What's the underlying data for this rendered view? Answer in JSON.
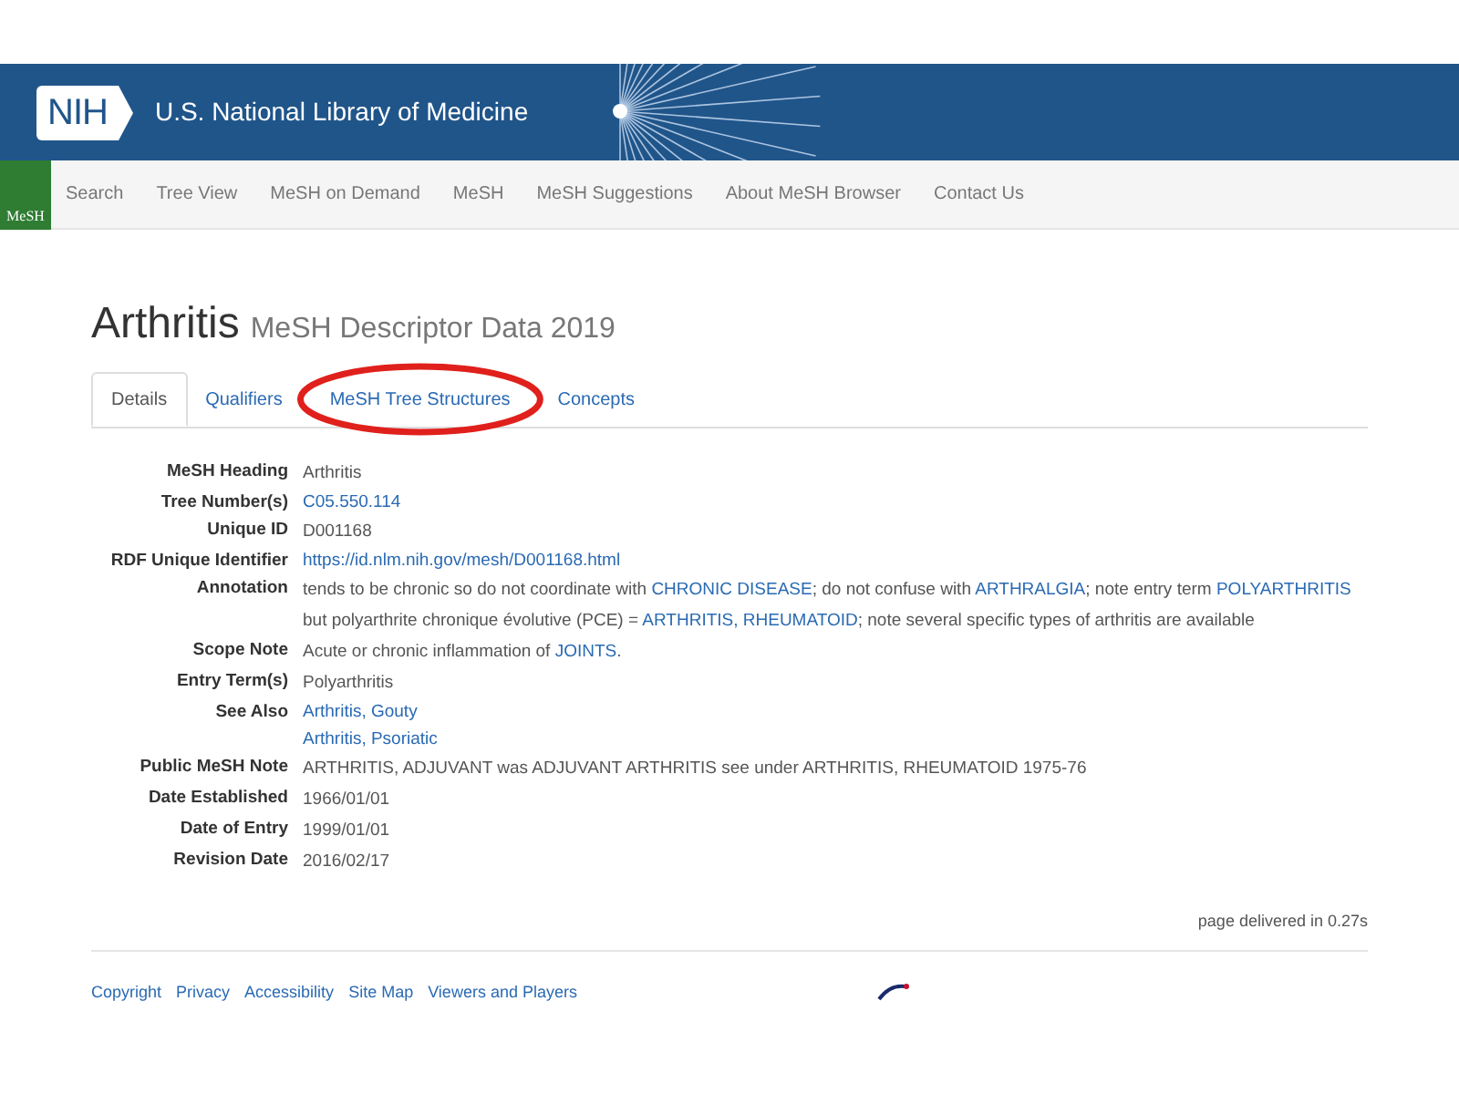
{
  "banner": {
    "logo": "NIH",
    "title": "U.S. National Library of Medicine"
  },
  "nav": {
    "logo": "MeSH",
    "items": [
      "Search",
      "Tree View",
      "MeSH on Demand",
      "MeSH",
      "MeSH Suggestions",
      "About MeSH Browser",
      "Contact Us"
    ]
  },
  "heading": {
    "title": "Arthritis",
    "subtitle": "MeSH Descriptor Data 2019"
  },
  "tabs": [
    {
      "label": "Details",
      "selected": true,
      "circled": false
    },
    {
      "label": "Qualifiers",
      "selected": false,
      "circled": false
    },
    {
      "label": "MeSH Tree Structures",
      "selected": false,
      "circled": true
    },
    {
      "label": "Concepts",
      "selected": false,
      "circled": false
    }
  ],
  "fields": [
    {
      "label": "MeSH Heading",
      "lines": [
        [
          {
            "kind": "text",
            "text": "Arthritis"
          }
        ]
      ]
    },
    {
      "label": "Tree Number(s)",
      "lines": [
        [
          {
            "kind": "link",
            "text": "C05.550.114"
          }
        ]
      ]
    },
    {
      "label": "Unique ID",
      "lines": [
        [
          {
            "kind": "text",
            "text": "D001168"
          }
        ]
      ]
    },
    {
      "label": "RDF Unique Identifier",
      "lines": [
        [
          {
            "kind": "link",
            "text": "https://id.nlm.nih.gov/mesh/D001168.html"
          }
        ]
      ]
    },
    {
      "label": "Annotation",
      "lines": [
        [
          {
            "kind": "text",
            "text": "tends to be chronic so do not coordinate with "
          },
          {
            "kind": "link",
            "text": "CHRONIC DISEASE"
          },
          {
            "kind": "text",
            "text": "; do not confuse with "
          },
          {
            "kind": "link",
            "text": "ARTHRALGIA"
          },
          {
            "kind": "text",
            "text": "; note entry term "
          },
          {
            "kind": "link",
            "text": "POLYARTHRITIS"
          },
          {
            "kind": "text",
            "text": " but polyarthrite chronique évolutive (PCE) = "
          },
          {
            "kind": "link",
            "text": "ARTHRITIS, RHEUMATOID"
          },
          {
            "kind": "text",
            "text": "; note several specific types of arthritis are available"
          }
        ]
      ]
    },
    {
      "label": "Scope Note",
      "lines": [
        [
          {
            "kind": "text",
            "text": "Acute or chronic inflammation of "
          },
          {
            "kind": "link",
            "text": "JOINTS"
          },
          {
            "kind": "text",
            "text": "."
          }
        ]
      ]
    },
    {
      "label": "Entry Term(s)",
      "lines": [
        [
          {
            "kind": "text",
            "text": "Polyarthritis"
          }
        ]
      ]
    },
    {
      "label": "See Also",
      "lines": [
        [
          {
            "kind": "link",
            "text": "Arthritis, Gouty"
          }
        ],
        [
          {
            "kind": "link",
            "text": "Arthritis, Psoriatic"
          }
        ]
      ]
    },
    {
      "label": "Public MeSH Note",
      "lines": [
        [
          {
            "kind": "text",
            "text": "ARTHRITIS, ADJUVANT was ADJUVANT ARTHRITIS see under ARTHRITIS, RHEUMATOID 1975-76"
          }
        ]
      ]
    },
    {
      "label": "Date Established",
      "lines": [
        [
          {
            "kind": "text",
            "text": "1966/01/01"
          }
        ]
      ]
    },
    {
      "label": "Date of Entry",
      "lines": [
        [
          {
            "kind": "text",
            "text": "1999/01/01"
          }
        ]
      ]
    },
    {
      "label": "Revision Date",
      "lines": [
        [
          {
            "kind": "text",
            "text": "2016/02/17"
          }
        ]
      ]
    }
  ],
  "timing": "page delivered in 0.27s",
  "footer_links": [
    "Copyright",
    "Privacy",
    "Accessibility",
    "Site Map",
    "Viewers and Players"
  ]
}
